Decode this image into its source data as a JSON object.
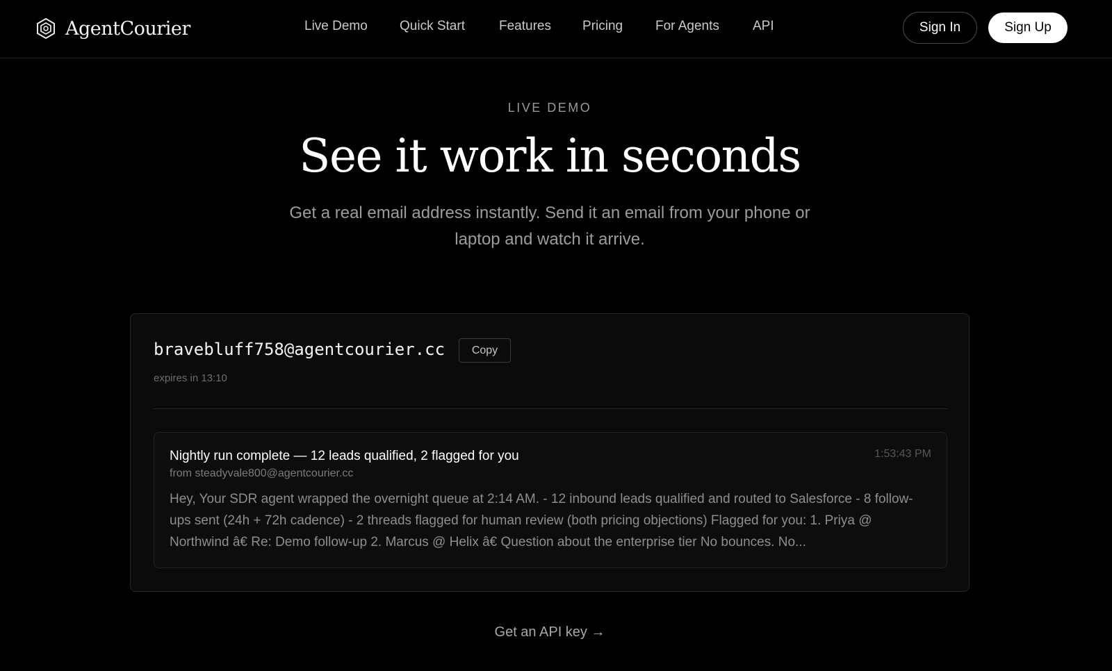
{
  "header": {
    "brand_name": "AgentCourier",
    "brand_icon": "hexagon-logo-icon",
    "nav": [
      {
        "label": "Live Demo"
      },
      {
        "label": "Quick Start"
      },
      {
        "label": "Features"
      },
      {
        "label": "Pricing"
      },
      {
        "label": "For Agents"
      },
      {
        "label": "API"
      }
    ],
    "sign_in_label": "Sign In",
    "sign_up_label": "Sign Up"
  },
  "hero": {
    "eyebrow": "LIVE DEMO",
    "title": "See it work in seconds",
    "subtitle": "Get a real email address instantly. Send it an email from your phone or laptop and watch it arrive."
  },
  "demo": {
    "address": "bravebluff758@agentcourier.cc",
    "copy_label": "Copy",
    "expires": "expires in 13:10",
    "messages": [
      {
        "subject": "Nightly run complete — 12 leads qualified, 2 flagged for you",
        "from": "from steadyvale800@agentcourier.cc",
        "time": "1:53:43 PM",
        "preview": "Hey, Your SDR agent wrapped the overnight queue at 2:14 AM. - 12 inbound leads qualified and routed to Salesforce - 8 follow-ups sent (24h + 72h cadence) - 2 threads flagged for human review (both pricing objections) Flagged for you: 1. Priya @ Northwind â€    Re: Demo follow-up 2. Marcus @ Helix â€    Question about the enterprise tier No bounces. No..."
      }
    ]
  },
  "footer": {
    "api_link": "Get an API key →"
  },
  "colors": {
    "background": "#000000",
    "card": "#0b0b0b",
    "border": "#262626",
    "text_primary": "#ffffff",
    "text_muted": "#9c9c9c"
  }
}
